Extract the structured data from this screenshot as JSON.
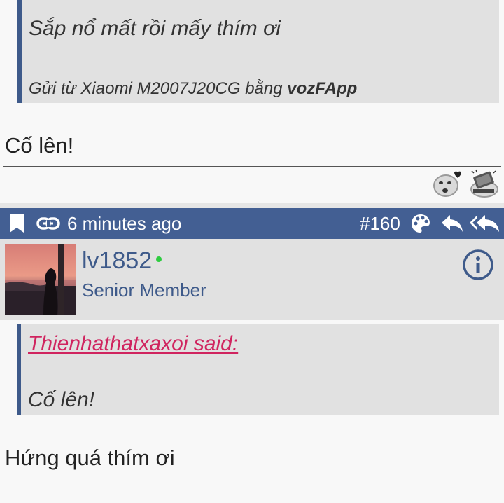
{
  "prev_post": {
    "quote_text": "Sắp nổ mất rồi mấy thím ơi",
    "sent_from_prefix": "Gửi từ Xiaomi M2007J20CG bằng ",
    "sent_from_app": "vozFApp",
    "reply_text": "Cố lên!",
    "reactions": [
      "kiss-emoji-icon",
      "computer-smash-emoji-icon"
    ]
  },
  "post": {
    "time": "6 minutes ago",
    "number": "#160",
    "icons": [
      "bookmark-icon",
      "link-icon",
      "palette-icon",
      "reply-icon",
      "reply-all-icon"
    ],
    "bar_color": "#435f93",
    "user": {
      "name": "lv1852",
      "role": "Senior Member",
      "online": true
    },
    "quote": {
      "author": "Thienhathatxaxoi said:",
      "text": "Cố lên!"
    },
    "body": "Hứng quá thím ơi"
  }
}
